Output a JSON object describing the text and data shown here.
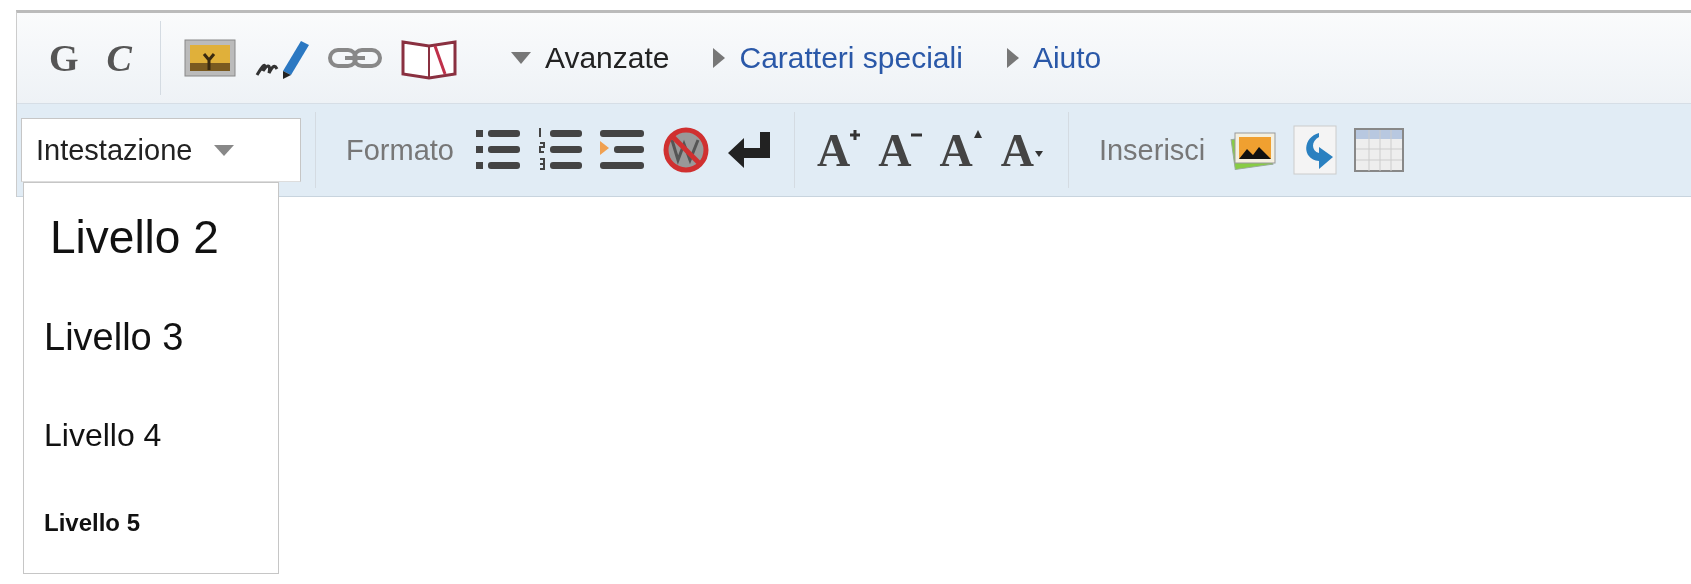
{
  "main_toolbar": {
    "style_buttons": [
      {
        "kind": "bold",
        "label": "G"
      },
      {
        "kind": "italic",
        "label": "C"
      }
    ],
    "sections": [
      {
        "label": "Avanzate",
        "expanded": true
      },
      {
        "label": "Caratteri speciali",
        "expanded": false
      },
      {
        "label": "Aiuto",
        "expanded": false
      }
    ]
  },
  "advanced_toolbar": {
    "heading_dropdown": {
      "label": "Intestazione",
      "expanded": true,
      "options": [
        {
          "label": "Livello 2",
          "kind": "h2"
        },
        {
          "label": "Livello 3",
          "kind": "h3"
        },
        {
          "label": "Livello 4",
          "kind": "h4"
        },
        {
          "label": "Livello 5",
          "kind": "h5"
        }
      ]
    },
    "format_label": "Formato",
    "size_buttons": [
      {
        "label": "A",
        "kind": "bigger"
      },
      {
        "label": "A",
        "kind": "smaller"
      },
      {
        "label": "A",
        "kind": "superscript"
      },
      {
        "label": "A",
        "kind": "subscript"
      }
    ],
    "insert_label": "Inserisci"
  }
}
